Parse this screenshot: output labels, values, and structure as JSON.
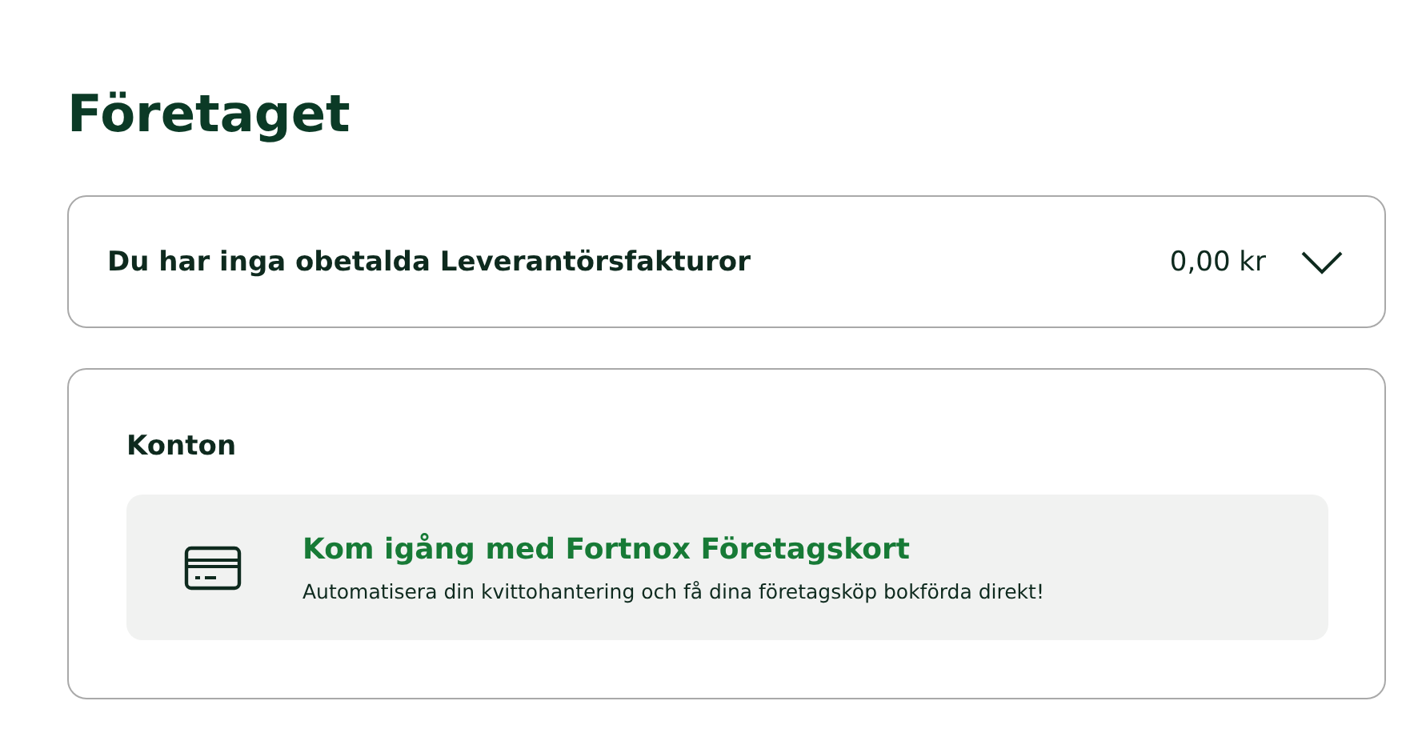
{
  "page": {
    "title": "Företaget"
  },
  "invoices": {
    "label": "Du har inga obetalda Leverantörsfakturor",
    "amount": "0,00 kr",
    "expanded": false
  },
  "accounts": {
    "heading": "Konton",
    "promo": {
      "title": "Kom igång med Fortnox Företagskort",
      "text": "Automatisera din kvittohantering och få dina företagsköp bokförda direkt!"
    }
  }
}
